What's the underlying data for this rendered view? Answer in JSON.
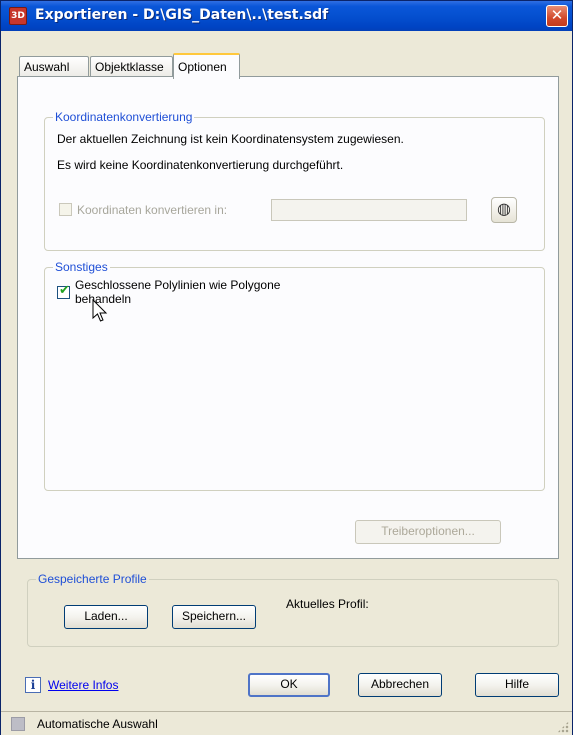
{
  "window": {
    "title": "Exportieren - D:\\GIS_Daten\\..\\test.sdf",
    "app_icon_text": "3D",
    "close_symbol": "✕"
  },
  "tabs": [
    {
      "label": "Auswahl",
      "active": false
    },
    {
      "label": "Objektklasse",
      "active": false
    },
    {
      "label": "Optionen",
      "active": true
    }
  ],
  "koordinaten": {
    "title": "Koordinatenkonvertierung",
    "line1": "Der aktuellen Zeichnung ist kein Koordinatensystem zugewiesen.",
    "line2": "Es wird keine Koordinatenkonvertierung durchgeführt.",
    "checkbox_label": "Koordinaten konvertieren in:",
    "checkbox_checked": false,
    "checkbox_enabled": false,
    "field_value": "",
    "globe_icon": "globe-icon",
    "globe_symbol": "◍"
  },
  "sonstiges": {
    "title": "Sonstiges",
    "checkbox_line1": "Geschlossene Polylinien wie Polygone",
    "checkbox_line2": "behandeln",
    "checkbox_checked": true,
    "check_symbol": "✔"
  },
  "treiber_button": "Treiberoptionen...",
  "profile": {
    "title": "Gespeicherte Profile",
    "load_button": "Laden...",
    "save_button": "Speichern...",
    "current_label": "Aktuelles Profil:"
  },
  "footer": {
    "info_symbol": "i",
    "more_info_link": "Weitere Infos",
    "ok_button": "OK",
    "cancel_button": "Abbrechen",
    "help_button": "Hilfe"
  },
  "statusbar": {
    "text": "Automatische Auswahl"
  },
  "colors": {
    "title_bar": "#0550d0",
    "group_title": "#1f4fd6",
    "dialog_bg": "#ece9d8",
    "link": "#0000ee",
    "close_button": "#d2492c",
    "active_tab_accent": "#ffc83c"
  }
}
